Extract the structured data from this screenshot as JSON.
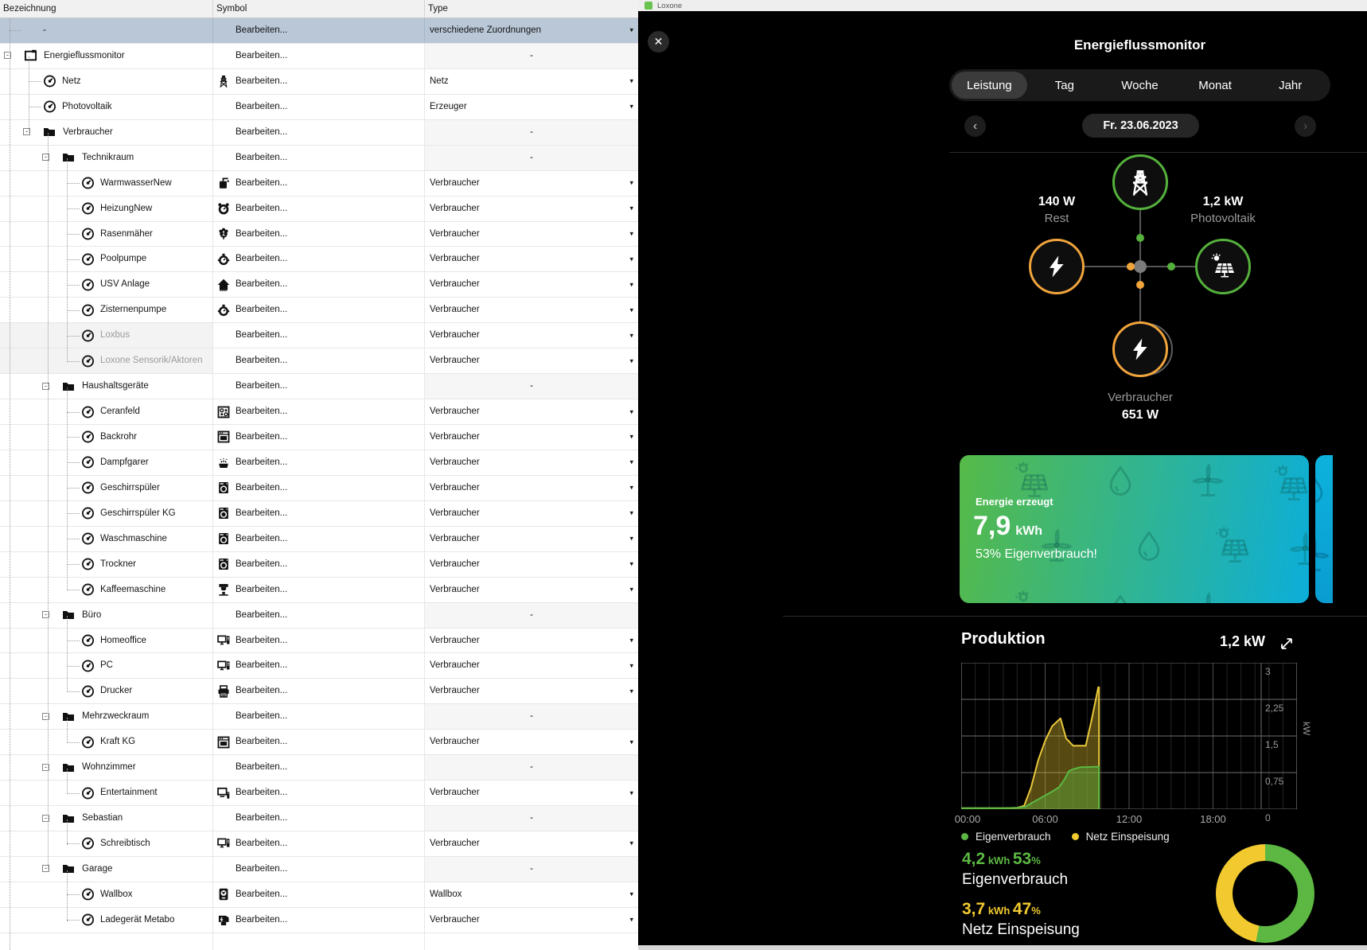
{
  "titlebar": {
    "app": "Loxone"
  },
  "table": {
    "columns": [
      "Bezeichnung",
      "Symbol",
      "Type"
    ],
    "edit_label": "Bearbeiten...",
    "rows": [
      {
        "label": "-",
        "level": 0,
        "type": "verschiedene Zuordnungen",
        "arrow": true,
        "selected": true
      },
      {
        "label": "Energieflussmonitor",
        "level": 0,
        "box": true,
        "icon": "window",
        "dash": true
      },
      {
        "label": "Netz",
        "level": 1,
        "icon": "gauge",
        "sym": "tower",
        "type": "Netz",
        "arrow": true
      },
      {
        "label": "Photovoltaik",
        "level": 1,
        "icon": "gauge",
        "type": "Erzeuger",
        "arrow": true
      },
      {
        "label": "Verbraucher",
        "level": 1,
        "box": true,
        "icon": "folder",
        "dash": true
      },
      {
        "label": "Technikraum",
        "level": 2,
        "box": true,
        "icon": "folder",
        "dash": true
      },
      {
        "label": "WarmwasserNew",
        "level": 3,
        "icon": "gauge",
        "sym": "boiler",
        "type": "Verbraucher",
        "arrow": true
      },
      {
        "label": "HeizungNew",
        "level": 3,
        "icon": "gauge",
        "sym": "motor",
        "type": "Verbraucher",
        "arrow": true
      },
      {
        "label": "Rasenmäher",
        "level": 3,
        "icon": "gauge",
        "sym": "flower",
        "type": "Verbraucher",
        "arrow": true
      },
      {
        "label": "Poolpumpe",
        "level": 3,
        "icon": "gauge",
        "sym": "pump",
        "type": "Verbraucher",
        "arrow": true
      },
      {
        "label": "USV Anlage",
        "level": 3,
        "icon": "gauge",
        "sym": "house",
        "type": "Verbraucher",
        "arrow": true
      },
      {
        "label": "Zisternenpumpe",
        "level": 3,
        "icon": "gauge",
        "sym": "pump",
        "type": "Verbraucher",
        "arrow": true
      },
      {
        "label": "Loxbus",
        "level": 3,
        "icon": "gauge",
        "type": "Verbraucher",
        "arrow": true,
        "gray": true
      },
      {
        "label": "Loxone Sensorik/Aktoren",
        "level": 3,
        "icon": "gauge",
        "type": "Verbraucher",
        "arrow": true,
        "gray": true
      },
      {
        "label": "Haushaltsgeräte",
        "level": 2,
        "box": true,
        "icon": "folder",
        "dash": true
      },
      {
        "label": "Ceranfeld",
        "level": 3,
        "icon": "gauge",
        "sym": "cooktop",
        "type": "Verbraucher",
        "arrow": true
      },
      {
        "label": "Backrohr",
        "level": 3,
        "icon": "gauge",
        "sym": "oven",
        "type": "Verbraucher",
        "arrow": true
      },
      {
        "label": "Dampfgarer",
        "level": 3,
        "icon": "gauge",
        "sym": "steamer",
        "type": "Verbraucher",
        "arrow": true
      },
      {
        "label": "Geschirrspüler",
        "level": 3,
        "icon": "gauge",
        "sym": "washer",
        "type": "Verbraucher",
        "arrow": true
      },
      {
        "label": "Geschirrspüler KG",
        "level": 3,
        "icon": "gauge",
        "sym": "washer",
        "type": "Verbraucher",
        "arrow": true
      },
      {
        "label": "Waschmaschine",
        "level": 3,
        "icon": "gauge",
        "sym": "washer",
        "type": "Verbraucher",
        "arrow": true
      },
      {
        "label": "Trockner",
        "level": 3,
        "icon": "gauge",
        "sym": "washer",
        "type": "Verbraucher",
        "arrow": true
      },
      {
        "label": "Kaffeemaschine",
        "level": 3,
        "icon": "gauge",
        "sym": "coffee",
        "type": "Verbraucher",
        "arrow": true
      },
      {
        "label": "Büro",
        "level": 2,
        "box": true,
        "icon": "folder",
        "dash": true
      },
      {
        "label": "Homeoffice",
        "level": 3,
        "icon": "gauge",
        "sym": "computer",
        "type": "Verbraucher",
        "arrow": true
      },
      {
        "label": "PC",
        "level": 3,
        "icon": "gauge",
        "sym": "computer",
        "type": "Verbraucher",
        "arrow": true
      },
      {
        "label": "Drucker",
        "level": 3,
        "icon": "gauge",
        "sym": "printer",
        "type": "Verbraucher",
        "arrow": true
      },
      {
        "label": "Mehrzweckraum",
        "level": 2,
        "box": true,
        "icon": "folder",
        "dash": true
      },
      {
        "label": "Kraft KG",
        "level": 3,
        "icon": "gauge",
        "sym": "oven",
        "type": "Verbraucher",
        "arrow": true
      },
      {
        "label": "Wohnzimmer",
        "level": 2,
        "box": true,
        "icon": "folder",
        "dash": true
      },
      {
        "label": "Entertainment",
        "level": 3,
        "icon": "gauge",
        "sym": "tv",
        "type": "Verbraucher",
        "arrow": true
      },
      {
        "label": "Sebastian",
        "level": 2,
        "box": true,
        "icon": "folder",
        "dash": true
      },
      {
        "label": "Schreibtisch",
        "level": 3,
        "icon": "gauge",
        "sym": "computer",
        "type": "Verbraucher",
        "arrow": true
      },
      {
        "label": "Garage",
        "level": 2,
        "box": true,
        "icon": "folder",
        "dash": true
      },
      {
        "label": "Wallbox",
        "level": 3,
        "icon": "gauge",
        "sym": "wallbox",
        "type": "Wallbox",
        "arrow": true
      },
      {
        "label": "Ladegerät Metabo",
        "level": 3,
        "icon": "gauge",
        "sym": "charger",
        "type": "Verbraucher",
        "arrow": true
      }
    ]
  },
  "overlay": {
    "title": "Energieflussmonitor",
    "close_glyph": "✕",
    "tabs": [
      {
        "label": "Leistung",
        "selected": true
      },
      {
        "label": "Tag"
      },
      {
        "label": "Woche"
      },
      {
        "label": "Monat"
      },
      {
        "label": "Jahr"
      }
    ],
    "date": {
      "prev": "‹",
      "label": "Fr. 23.06.2023",
      "next": "›"
    },
    "flow": {
      "rest": {
        "value": "140 W",
        "label": "Rest"
      },
      "photovoltaik": {
        "value": "1,2 kW",
        "label": "Photovoltaik"
      },
      "verbraucher": {
        "label": "Verbraucher",
        "value": "651 W"
      }
    },
    "energy_card": {
      "heading": "Energie erzeugt",
      "value": "7,9",
      "unit": "kWh",
      "subtitle": "53% Eigenverbrauch!"
    },
    "production": {
      "title": "Produktion",
      "current": "1,2 kW",
      "legend": [
        {
          "label": "Eigenverbrauch",
          "color": "#5cb843"
        },
        {
          "label": "Netz Einspeisung",
          "color": "#f2ca30"
        }
      ],
      "stats": [
        {
          "value": "4,2",
          "unit": "kWh",
          "pct": "53",
          "pct_sign": "%",
          "label": "Eigenverbrauch",
          "color": "#5cb843"
        },
        {
          "value": "3,7",
          "unit": "kWh",
          "pct": "47",
          "pct_sign": "%",
          "label": "Netz Einspeisung",
          "color": "#f2ca30"
        }
      ],
      "donut": [
        {
          "label": "Eigenverbrauch",
          "pct": 53,
          "color": "#5cb843"
        },
        {
          "label": "Netz Einspeisung",
          "pct": 47,
          "color": "#f2ca30"
        }
      ]
    }
  },
  "chart_data": {
    "type": "area",
    "title": "Produktion",
    "current_value": "1,2 kW",
    "x_unit": "time_of_day_hours",
    "x_range": [
      0,
      24
    ],
    "y_unit": "kW",
    "y_range": [
      0,
      3
    ],
    "grid": true,
    "legend_position": "bottom-left",
    "y_ticks": [
      {
        "v": 3,
        "label": "3"
      },
      {
        "v": 2.25,
        "label": "2,25"
      },
      {
        "v": 1.5,
        "label": "1,5"
      },
      {
        "v": 0.75,
        "label": "0,75"
      },
      {
        "v": 0,
        "label": "0"
      }
    ],
    "x_ticks": [
      {
        "v": 0,
        "label": "00:00"
      },
      {
        "v": 6,
        "label": "06:00"
      },
      {
        "v": 12,
        "label": "12:00"
      },
      {
        "v": 18,
        "label": "18:00"
      }
    ],
    "series": [
      {
        "name": "Netz Einspeisung",
        "color": "#e9c83a",
        "fill": "rgba(226,192,45,0.38)",
        "cutoff": 9.85,
        "points": [
          [
            0,
            0.02
          ],
          [
            1,
            0.02
          ],
          [
            2,
            0.02
          ],
          [
            3,
            0.02
          ],
          [
            4,
            0.03
          ],
          [
            4.5,
            0.07
          ],
          [
            5,
            0.45
          ],
          [
            5.5,
            1.0
          ],
          [
            6,
            1.4
          ],
          [
            6.5,
            1.7
          ],
          [
            7.1,
            1.86
          ],
          [
            7.5,
            1.45
          ],
          [
            8.0,
            1.3
          ],
          [
            8.9,
            1.3
          ],
          [
            9.3,
            1.8
          ],
          [
            9.8,
            2.5
          ],
          [
            9.85,
            2.5
          ]
        ]
      },
      {
        "name": "Eigenverbrauch",
        "color": "#5cb843",
        "fill": "rgba(92,184,67,0.42)",
        "cutoff": 9.85,
        "points": [
          [
            0,
            0.02
          ],
          [
            3,
            0.02
          ],
          [
            4,
            0.03
          ],
          [
            4.6,
            0.05
          ],
          [
            5,
            0.12
          ],
          [
            5.5,
            0.2
          ],
          [
            6,
            0.28
          ],
          [
            6.5,
            0.36
          ],
          [
            7,
            0.45
          ],
          [
            7.4,
            0.62
          ],
          [
            7.7,
            0.78
          ],
          [
            8,
            0.82
          ],
          [
            8.5,
            0.86
          ],
          [
            9.85,
            0.87
          ]
        ]
      }
    ]
  },
  "colors": {
    "loxone_green": "#69c350",
    "ring_green": "#55b13c",
    "ring_orange": "#f0a43c",
    "selected_row": "#b9c7d7",
    "card_gradient": [
      "#56ba48",
      "#0caed9"
    ]
  }
}
